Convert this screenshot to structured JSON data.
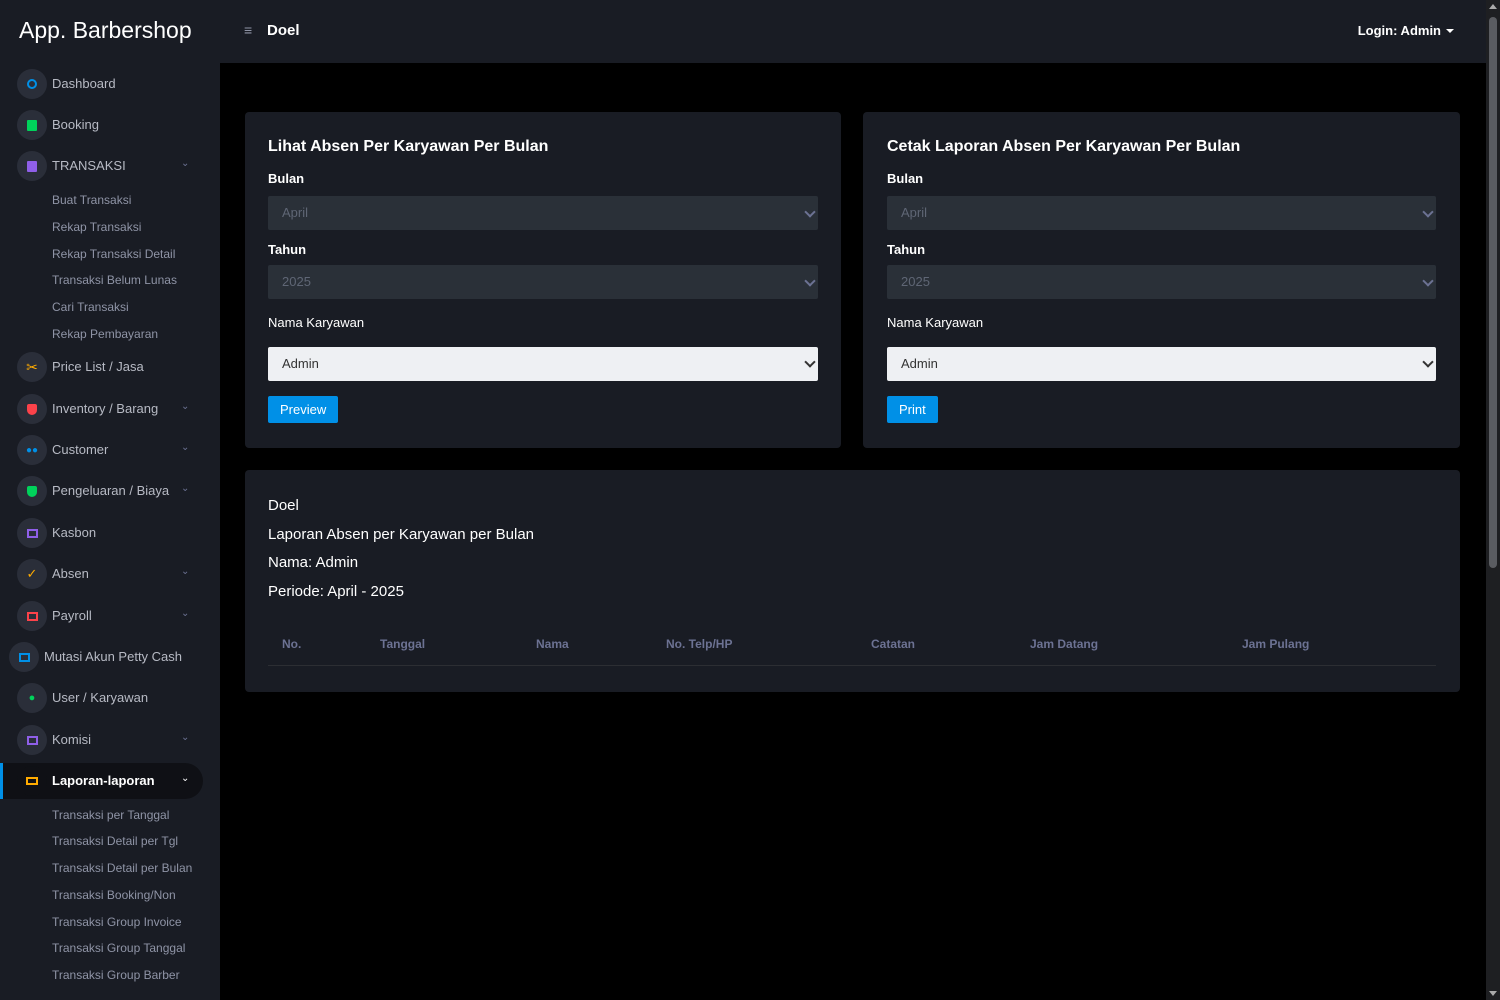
{
  "header": {
    "brand": "App. Barbershop",
    "page_title": "Doel",
    "login": "Login: Admin"
  },
  "sidebar": {
    "items": [
      {
        "label": "Dashboard",
        "icon": "speedometer-icon",
        "color": "#0090e7"
      },
      {
        "label": "Booking",
        "icon": "list-icon",
        "color": "#00d25b"
      },
      {
        "label": "TRANSAKSI",
        "icon": "document-icon",
        "color": "#8f5fe8"
      },
      {
        "label": "Price List / Jasa",
        "icon": "scissors-icon",
        "color": "#ffab00"
      },
      {
        "label": "Inventory / Barang",
        "icon": "shield-icon",
        "color": "#fc424a"
      },
      {
        "label": "Customer",
        "icon": "users-icon",
        "color": "#0090e7"
      },
      {
        "label": "Pengeluaran / Biaya",
        "icon": "security-icon",
        "color": "#00d25b"
      },
      {
        "label": "Kasbon",
        "icon": "cash-icon",
        "color": "#8f5fe8"
      },
      {
        "label": "Absen",
        "icon": "check-icon",
        "color": "#ffab00"
      },
      {
        "label": "Payroll",
        "icon": "payroll-icon",
        "color": "#fc424a"
      },
      {
        "label": "Mutasi Akun Petty Cash",
        "icon": "cash-icon",
        "color": "#0090e7"
      },
      {
        "label": "User / Karyawan",
        "icon": "user-icon",
        "color": "#00d25b"
      },
      {
        "label": "Komisi",
        "icon": "cash-icon",
        "color": "#8f5fe8"
      },
      {
        "label": "Laporan-laporan",
        "icon": "laptop-icon",
        "color": "#ffab00"
      }
    ],
    "transaksi_sub": [
      "Buat Transaksi",
      "Rekap Transaksi",
      "Rekap Transaksi Detail",
      "Transaksi Belum Lunas",
      "Cari Transaksi",
      "Rekap Pembayaran"
    ],
    "laporan_sub": [
      "Transaksi per Tanggal",
      "Transaksi Detail per Tgl",
      "Transaksi Detail per Bulan",
      "Transaksi Booking/Non",
      "Transaksi Group Invoice",
      "Transaksi Group Tanggal",
      "Transaksi Group Barber"
    ]
  },
  "card_view": {
    "title": "Lihat Absen Per Karyawan Per Bulan",
    "bulan_label": "Bulan",
    "bulan_value": "April",
    "tahun_label": "Tahun",
    "tahun_value": "2025",
    "karyawan_label": "Nama Karyawan",
    "karyawan_value": "Admin",
    "button": "Preview"
  },
  "card_print": {
    "title": "Cetak Laporan Absen Per Karyawan Per Bulan",
    "bulan_label": "Bulan",
    "bulan_value": "April",
    "tahun_label": "Tahun",
    "tahun_value": "2025",
    "karyawan_label": "Nama Karyawan",
    "karyawan_value": "Admin",
    "button": "Print"
  },
  "report": {
    "company": "Doel",
    "title": "Laporan Absen per Karyawan per Bulan",
    "nama": "Nama: Admin",
    "periode": "Periode: April - 2025",
    "columns": [
      "No.",
      "Tanggal",
      "Nama",
      "No. Telp/HP",
      "Catatan",
      "Jam Datang",
      "Jam Pulang"
    ],
    "rows": []
  },
  "colors": {
    "accent": "#0090e7",
    "panel": "#191c24"
  }
}
